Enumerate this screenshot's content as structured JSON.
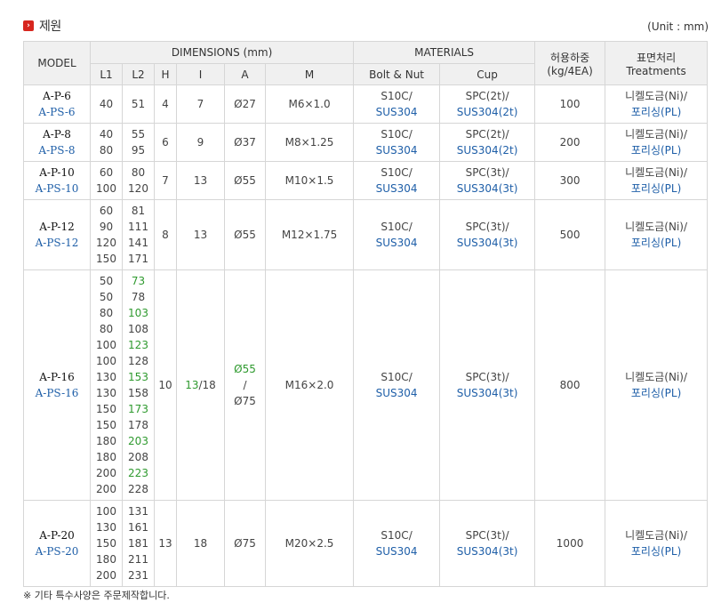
{
  "section_title": "제원",
  "unit": "(Unit : mm)",
  "header": {
    "model": "MODEL",
    "dimensions": "DIMENSIONS (mm)",
    "materials": "MATERIALS",
    "load": [
      "허용하중",
      "(kg/4EA)"
    ],
    "treatment": [
      "표면처리",
      "Treatments"
    ],
    "sub": {
      "l1": "L1",
      "l2": "L2",
      "h": "H",
      "i": "I",
      "a": "A",
      "m": "M",
      "bolt": "Bolt & Nut",
      "cup": "Cup"
    }
  },
  "rows": [
    {
      "model": [
        "A-P-6",
        "A-PS-6"
      ],
      "l1": [
        "40"
      ],
      "l2": [
        "51"
      ],
      "h": "4",
      "i": [
        "7"
      ],
      "a": [
        "Ø27"
      ],
      "m": "M6×1.0",
      "bolt": [
        "S10C/",
        "SUS304"
      ],
      "cup": [
        "SPC(2t)/",
        "SUS304(2t)"
      ],
      "load": "100",
      "treat": [
        "니켈도금(Ni)/",
        "포리싱(PL)"
      ]
    },
    {
      "model": [
        "A-P-8",
        "A-PS-8"
      ],
      "l1": [
        "40",
        "80"
      ],
      "l2": [
        "55",
        "95"
      ],
      "h": "6",
      "i": [
        "9"
      ],
      "a": [
        "Ø37"
      ],
      "m": "M8×1.25",
      "bolt": [
        "S10C/",
        "SUS304"
      ],
      "cup": [
        "SPC(2t)/",
        "SUS304(2t)"
      ],
      "load": "200",
      "treat": [
        "니켈도금(Ni)/",
        "포리싱(PL)"
      ]
    },
    {
      "model": [
        "A-P-10",
        "A-PS-10"
      ],
      "l1": [
        "60",
        "100"
      ],
      "l2": [
        "80",
        "120"
      ],
      "h": "7",
      "i": [
        "13"
      ],
      "a": [
        "Ø55"
      ],
      "m": "M10×1.5",
      "bolt": [
        "S10C/",
        "SUS304"
      ],
      "cup": [
        "SPC(3t)/",
        "SUS304(3t)"
      ],
      "load": "300",
      "treat": [
        "니켈도금(Ni)/",
        "포리싱(PL)"
      ]
    },
    {
      "model": [
        "A-P-12",
        "A-PS-12"
      ],
      "l1": [
        "60",
        "90",
        "120",
        "150"
      ],
      "l2": [
        "81",
        "111",
        "141",
        "171"
      ],
      "h": "8",
      "i": [
        "13"
      ],
      "a": [
        "Ø55"
      ],
      "m": "M12×1.75",
      "bolt": [
        "S10C/",
        "SUS304"
      ],
      "cup": [
        "SPC(3t)/",
        "SUS304(3t)"
      ],
      "load": "500",
      "treat": [
        "니켈도금(Ni)/",
        "포리싱(PL)"
      ]
    },
    {
      "model": [
        "A-P-16",
        "A-PS-16"
      ],
      "l1": [
        "50",
        "50",
        "80",
        "80",
        "100",
        "100",
        "130",
        "130",
        "150",
        "150",
        "180",
        "180",
        "200",
        "200"
      ],
      "l2": [
        "73",
        "78",
        "103",
        "108",
        "123",
        "128",
        "153",
        "158",
        "173",
        "178",
        "203",
        "208",
        "223",
        "228"
      ],
      "l2_green": [
        true,
        false,
        true,
        false,
        true,
        false,
        true,
        false,
        true,
        false,
        true,
        false,
        true,
        false
      ],
      "h": "10",
      "i": [
        "13",
        "/18"
      ],
      "a": [
        "Ø55",
        "/",
        "Ø75"
      ],
      "m": "M16×2.0",
      "bolt": [
        "S10C/",
        "SUS304"
      ],
      "cup": [
        "SPC(3t)/",
        "SUS304(3t)"
      ],
      "load": "800",
      "treat": [
        "니켈도금(Ni)/",
        "포리싱(PL)"
      ]
    },
    {
      "model": [
        "A-P-20",
        "A-PS-20"
      ],
      "l1": [
        "100",
        "130",
        "150",
        "180",
        "200"
      ],
      "l2": [
        "131",
        "161",
        "181",
        "211",
        "231"
      ],
      "h": "13",
      "i": [
        "18"
      ],
      "a": [
        "Ø75"
      ],
      "m": "M20×2.5",
      "bolt": [
        "S10C/",
        "SUS304"
      ],
      "cup": [
        "SPC(3t)/",
        "SUS304(3t)"
      ],
      "load": "1000",
      "treat": [
        "니켈도금(Ni)/",
        "포리싱(PL)"
      ]
    }
  ],
  "note": "※ 기타 특수사양은 주문제작합니다.",
  "colors": {
    "accent_red": "#d7261e",
    "blue_text": "#1f5fa8",
    "green_text": "#2f9a2f",
    "header_bg": "#f0f0f0"
  }
}
